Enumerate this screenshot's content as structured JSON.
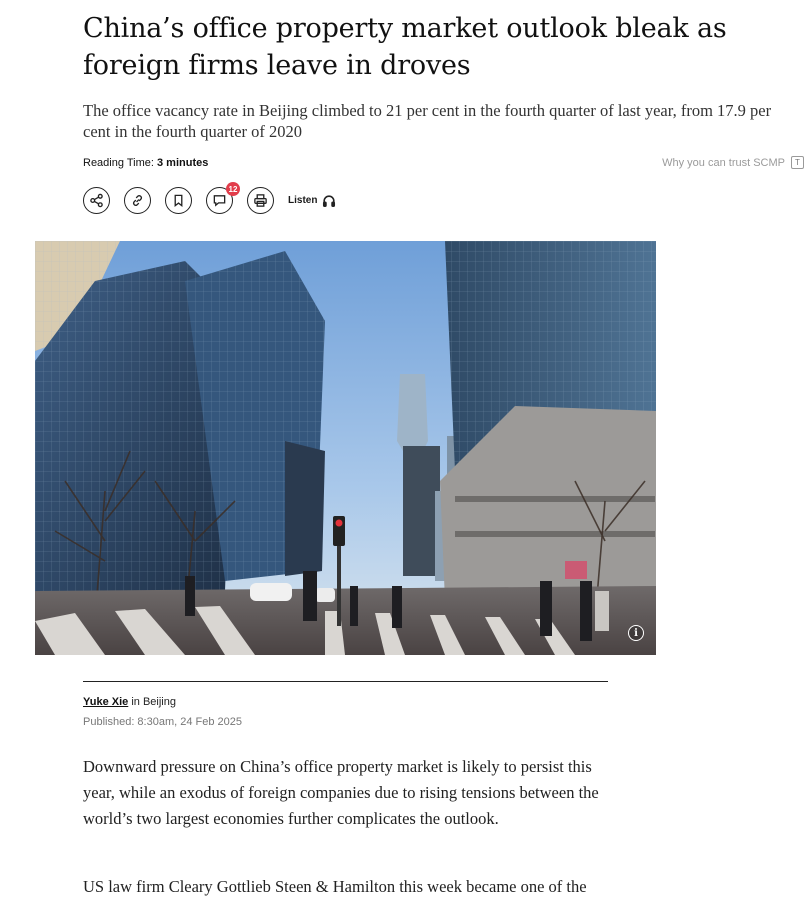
{
  "article": {
    "headline": "China’s office property market outlook bleak as foreign firms leave in droves",
    "subheadline": "The office vacancy rate in Beijing climbed to 21 per cent in the fourth quarter of last year, from 17.9 per cent in the fourth quarter of 2020",
    "reading_time_label": "Reading Time:",
    "reading_time_value": "3 minutes",
    "trust_link": "Why you can trust SCMP",
    "comment_count": "12",
    "listen_label": "Listen",
    "author": "Yuke Xie",
    "location": "in Beijing",
    "published": "Published: 8:30am, 24 Feb 2025",
    "paragraphs": [
      "Downward pressure on China’s office property market is likely to persist this year, while an exodus of foreign companies due to rising tensions between the world’s two largest economies further complicates the outlook.",
      "US law firm Cleary Gottlieb Steen & Hamilton this week became one of the"
    ]
  },
  "icons": {
    "share": "share-icon",
    "link": "link-icon",
    "bookmark": "bookmark-icon",
    "comment": "comment-icon",
    "print": "print-icon",
    "listen": "headphones-icon",
    "info": "info-icon"
  },
  "colors": {
    "badge": "#e23d4b",
    "text": "#1a1a1a",
    "muted": "#9a9a9a"
  }
}
